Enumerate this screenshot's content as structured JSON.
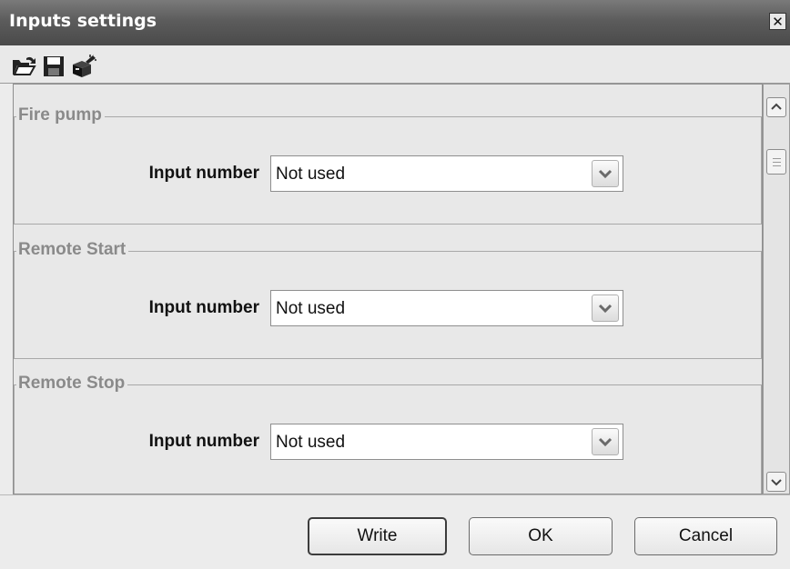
{
  "window": {
    "title": "Inputs settings",
    "close_symbol": "✕"
  },
  "toolbar": {
    "icons": [
      "open-folder-icon",
      "save-floppy-icon",
      "device-write-icon"
    ]
  },
  "groups": [
    {
      "title": "Fire pump",
      "field_label": "Input number",
      "value": "Not used"
    },
    {
      "title": "Remote Start",
      "field_label": "Input number",
      "value": "Not used"
    },
    {
      "title": "Remote Stop",
      "field_label": "Input number",
      "value": "Not used"
    }
  ],
  "buttons": {
    "write": "Write",
    "ok": "OK",
    "cancel": "Cancel"
  }
}
